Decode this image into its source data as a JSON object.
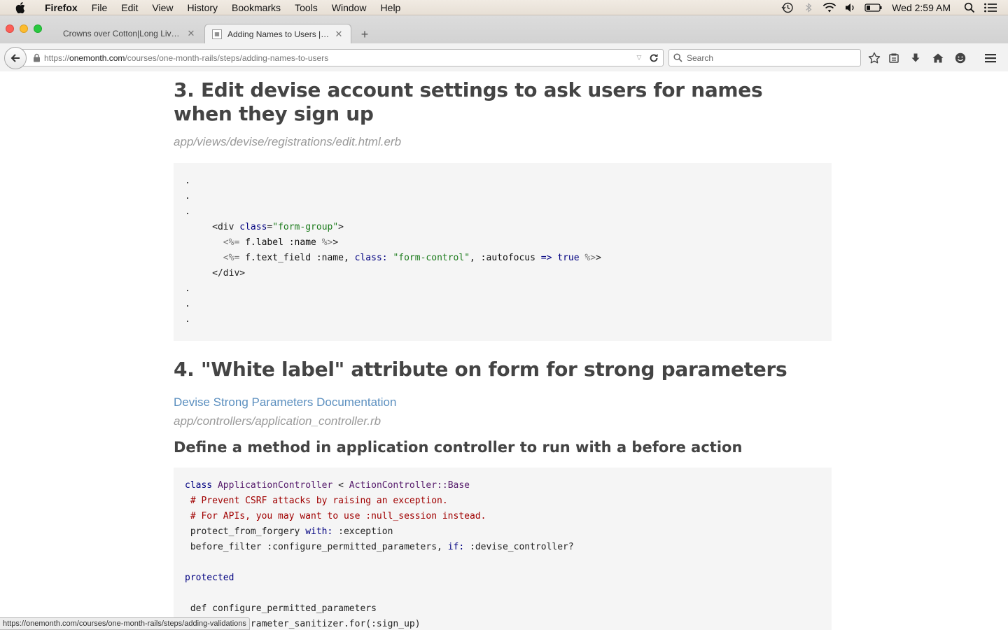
{
  "menubar": {
    "app_name": "Firefox",
    "items": [
      "File",
      "Edit",
      "View",
      "History",
      "Bookmarks",
      "Tools",
      "Window",
      "Help"
    ],
    "clock": "Wed 2:59 AM"
  },
  "tabs": [
    {
      "title": "Crowns over Cotton|Long Live C...",
      "active": false
    },
    {
      "title": "Adding Names to Users | O...",
      "active": true
    }
  ],
  "navbar": {
    "url_prefix": "https://",
    "url_domain": "onemonth.com",
    "url_path": "/courses/one-month-rails/steps/adding-names-to-users",
    "search_placeholder": "Search"
  },
  "content": {
    "heading3": "3. Edit devise account settings to ask users for names when they sign up",
    "file3": "app/views/devise/registrations/edit.html.erb",
    "heading4": "4. \"White label\" attribute on form for strong parameters",
    "doc_link": "Devise Strong Parameters Documentation",
    "file4": "app/controllers/application_controller.rb",
    "subheading": "Define a method in application controller to run with a before action"
  },
  "code1": {
    "dot": ".",
    "div_open": "<div ",
    "class_attr": "class",
    "eq": "=",
    "form_group": "\"form-group\"",
    "gt": ">",
    "erb_open": "<%=",
    "label_call": " f.label :name ",
    "erb_close": "%>",
    "text_field_call": " f.text_field :name, ",
    "class_key": "class:",
    "form_control": " \"form-control\"",
    "autofocus": ", :autofocus ",
    "arrow": "=>",
    "true_kw": " true ",
    "div_close": "</div>"
  },
  "code2": {
    "class_kw": "class",
    "class_name": " ApplicationController ",
    "lt": "<",
    "base_class": " ActionController::Base",
    "comment1": " # Prevent CSRF attacks by raising an exception.",
    "comment2": " # For APIs, you may want to use :null_session instead.",
    "protect": " protect_from_forgery ",
    "with_kw": "with:",
    "exception": " :exception",
    "before_filter": " before_filter :configure_permitted_parameters, ",
    "if_kw": "if:",
    "devise_ctrl": " :devise_controller?",
    "protected_kw": "protected",
    "def_line": " def configure_permitted_parameters",
    "partial_line": "   devise_parameter_sanitizer.for(:sign_up)"
  },
  "status_url": "https://onemonth.com/courses/one-month-rails/steps/adding-validations"
}
